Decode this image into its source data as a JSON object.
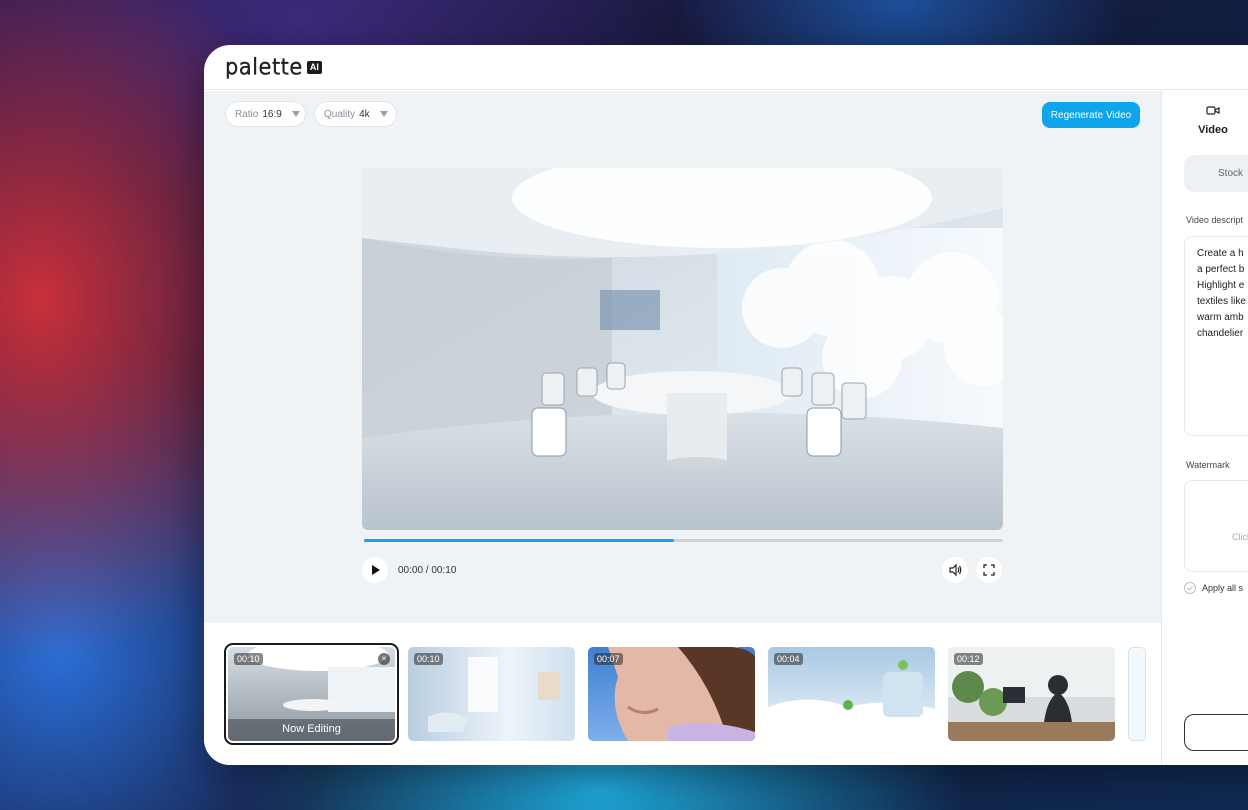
{
  "app": {
    "logo_text": "palette",
    "logo_badge": "AI"
  },
  "toolbar": {
    "ratio_label": "Ratio",
    "ratio_value": "16:9",
    "quality_label": "Quality",
    "quality_value": "4k",
    "regenerate_label": "Regenerate Video"
  },
  "player": {
    "time": "00:00 / 00:10",
    "progress": 0.485
  },
  "clips": [
    {
      "duration": "00:10",
      "status": "Now Editing"
    },
    {
      "duration": "00:10"
    },
    {
      "duration": "00:07"
    },
    {
      "duration": "00:04"
    },
    {
      "duration": "00:12"
    }
  ],
  "sidebar": {
    "tab_video": "Video",
    "stock_label": "Stock",
    "desc_label": "Video descript",
    "desc_lines": [
      "Create a h",
      "a perfect b",
      "Highlight e",
      "textiles like",
      "warm amb",
      "chandelier"
    ],
    "watermark_label": "Watermark",
    "watermark_hint": "Click",
    "apply_label": "Apply all s"
  },
  "colors": {
    "accent": "#0ea5ec",
    "progress": "#14a3ea"
  }
}
